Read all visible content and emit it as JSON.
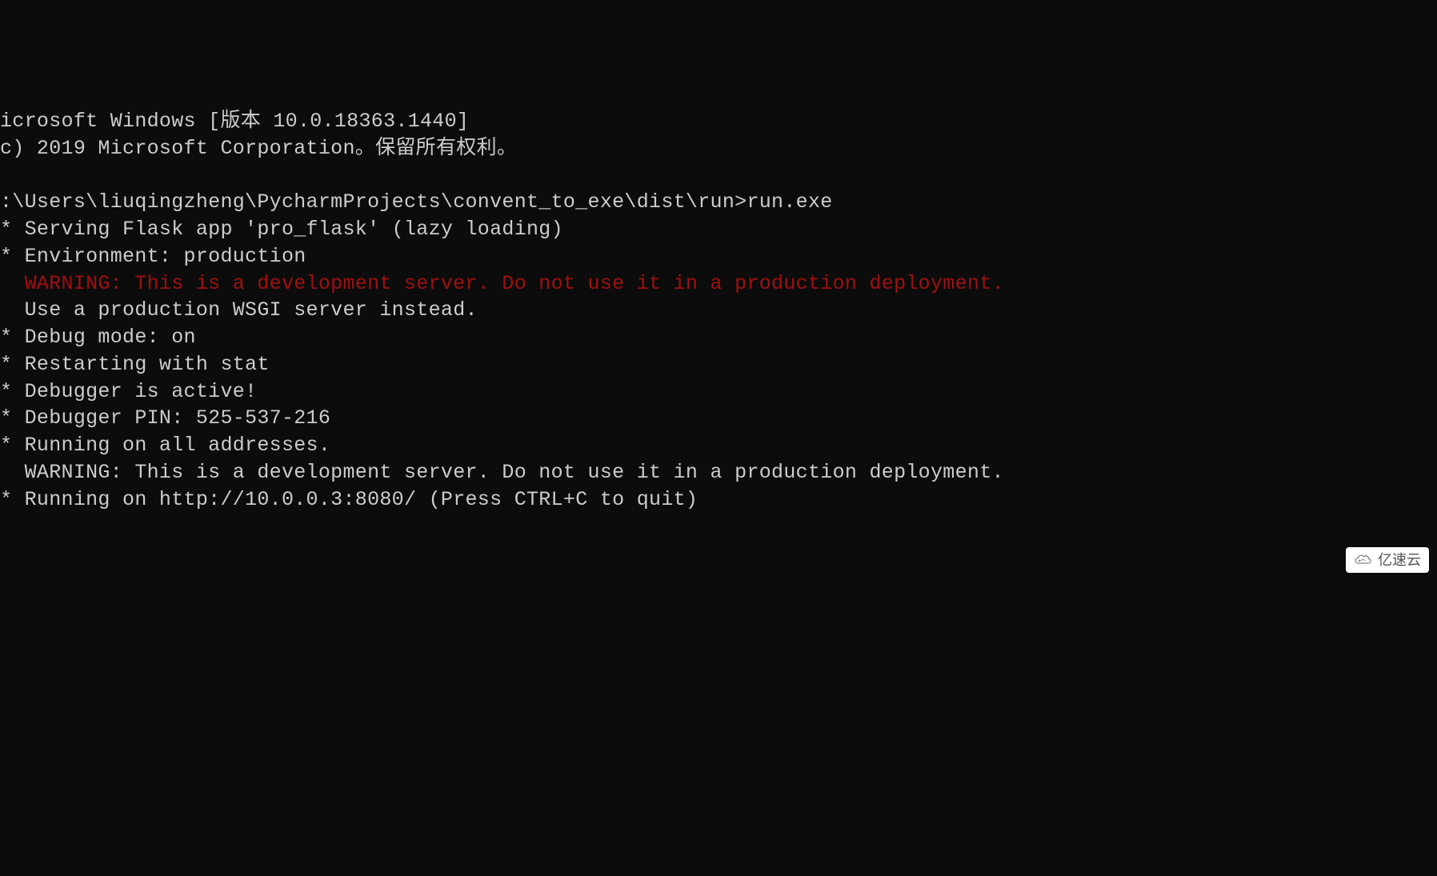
{
  "terminal": {
    "lines": [
      {
        "text": "icrosoft Windows [版本 10.0.18363.1440]",
        "cls": ""
      },
      {
        "text": "c) 2019 Microsoft Corporation。保留所有权利。",
        "cls": ""
      },
      {
        "text": "",
        "cls": ""
      },
      {
        "text": ":\\Users\\liuqingzheng\\PycharmProjects\\convent_to_exe\\dist\\run>run.exe",
        "cls": ""
      },
      {
        "text": "* Serving Flask app 'pro_flask' (lazy loading)",
        "cls": ""
      },
      {
        "text": "* Environment: production",
        "cls": ""
      },
      {
        "text": "  WARNING: This is a development server. Do not use it in a production deployment.",
        "cls": "red"
      },
      {
        "text": "  Use a production WSGI server instead.",
        "cls": ""
      },
      {
        "text": "* Debug mode: on",
        "cls": ""
      },
      {
        "text": "* Restarting with stat",
        "cls": ""
      },
      {
        "text": "* Debugger is active!",
        "cls": ""
      },
      {
        "text": "* Debugger PIN: 525-537-216",
        "cls": ""
      },
      {
        "text": "* Running on all addresses.",
        "cls": ""
      },
      {
        "text": "  WARNING: This is a development server. Do not use it in a production deployment.",
        "cls": ""
      },
      {
        "text": "* Running on http://10.0.0.3:8080/ (Press CTRL+C to quit)",
        "cls": ""
      }
    ]
  },
  "watermark": {
    "text": "亿速云"
  }
}
